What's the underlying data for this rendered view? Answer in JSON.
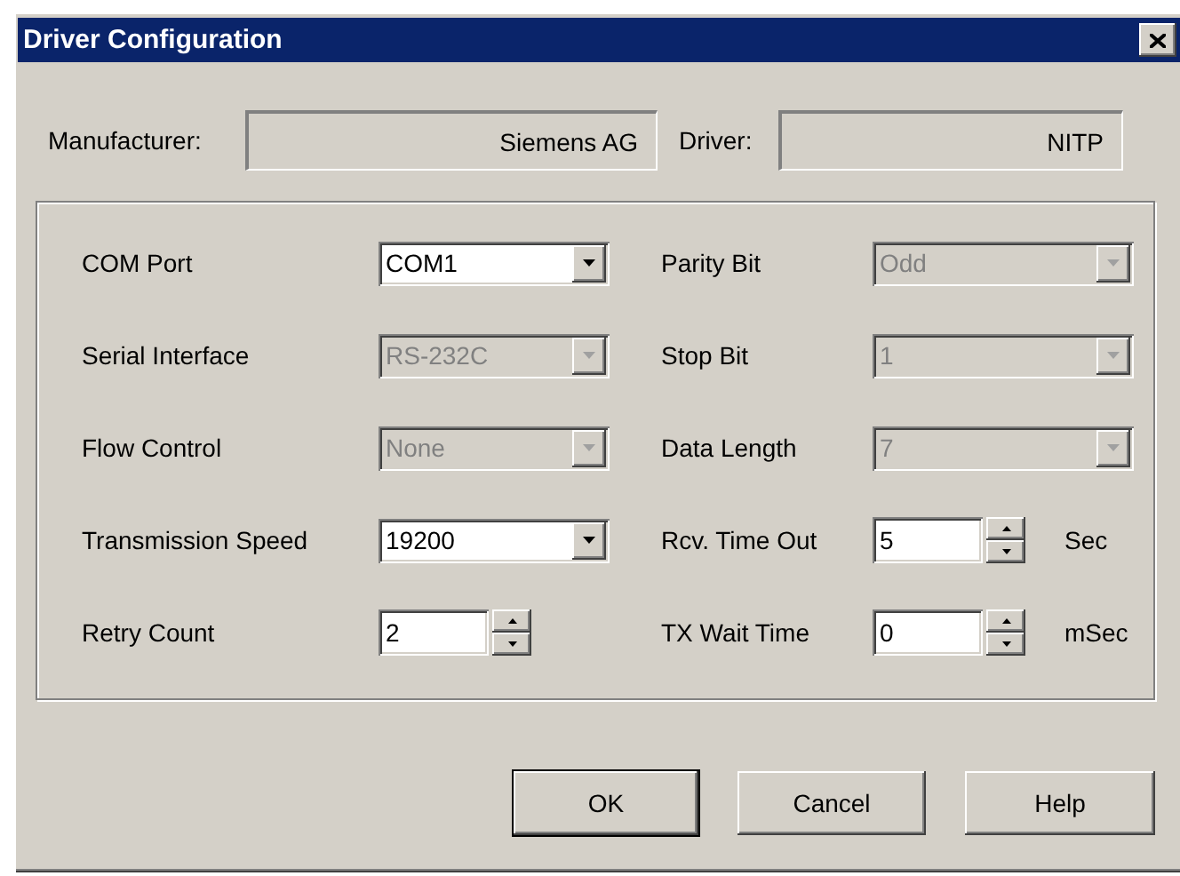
{
  "window": {
    "title": "Driver Configuration"
  },
  "header_fields": [
    {
      "label": "Manufacturer:",
      "value": "Siemens AG"
    },
    {
      "label": "Driver:",
      "value": "NITP"
    }
  ],
  "left_column": [
    {
      "label": "COM Port",
      "kind": "dropdown",
      "value": "COM1",
      "disabled": false
    },
    {
      "label": "Serial Interface",
      "kind": "dropdown",
      "value": "RS-232C",
      "disabled": true
    },
    {
      "label": "Flow Control",
      "kind": "dropdown",
      "value": "None",
      "disabled": true
    },
    {
      "label": "Transmission Speed",
      "kind": "dropdown",
      "value": "19200",
      "disabled": false
    },
    {
      "label": "Retry Count",
      "kind": "spinner",
      "value": "2",
      "disabled": false
    }
  ],
  "right_column": [
    {
      "label": "Parity Bit",
      "kind": "dropdown",
      "value": "Odd",
      "disabled": true
    },
    {
      "label": "Stop Bit",
      "kind": "dropdown",
      "value": "1",
      "disabled": true
    },
    {
      "label": "Data Length",
      "kind": "dropdown",
      "value": "7",
      "disabled": true
    },
    {
      "label": "Rcv. Time Out",
      "kind": "spinner",
      "value": "5",
      "unit": "Sec",
      "disabled": false
    },
    {
      "label": "TX Wait Time",
      "kind": "spinner",
      "value": "0",
      "unit": "mSec",
      "disabled": false
    }
  ],
  "buttons": [
    {
      "label": "OK",
      "default": true
    },
    {
      "label": "Cancel",
      "default": false
    },
    {
      "label": "Help",
      "default": false
    }
  ]
}
